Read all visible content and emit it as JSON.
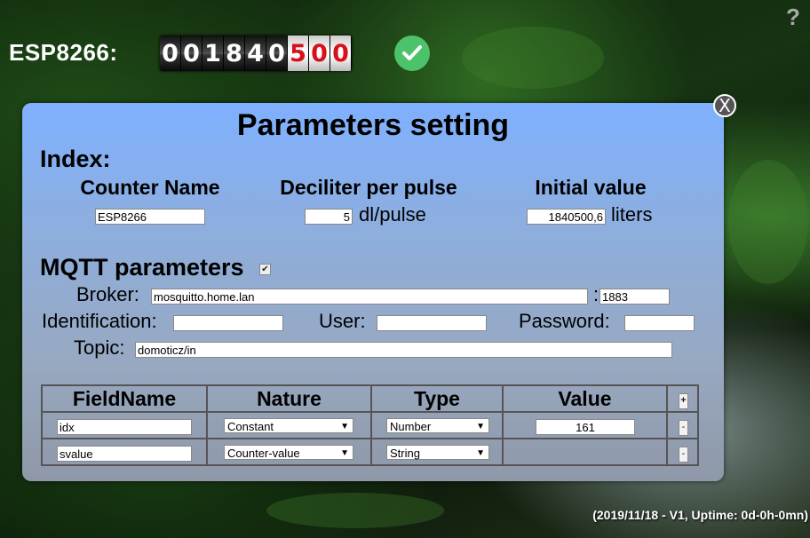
{
  "header": {
    "device_label": "ESP8266:",
    "counter_digits": [
      "0",
      "0",
      "1",
      "8",
      "4",
      "0",
      "5",
      "0",
      "0"
    ],
    "help_symbol": "?"
  },
  "dialog": {
    "title": "Parameters setting",
    "close_symbol": "X",
    "index": {
      "heading": "Index:",
      "counter_name_label": "Counter Name",
      "counter_name_value": "ESP8266",
      "deciliter_label": "Deciliter per pulse",
      "deciliter_value": "5",
      "deciliter_unit": "dl/pulse",
      "initial_label": "Initial value",
      "initial_value": "1840500,6",
      "initial_unit": "liters"
    },
    "mqtt": {
      "heading": "MQTT parameters",
      "enabled_mark": "✔",
      "broker_label": "Broker:",
      "broker_value": "mosquitto.home.lan",
      "port_separator": ":",
      "port_value": "1883",
      "identification_label": "Identification:",
      "identification_value": "",
      "user_label": "User:",
      "user_value": "",
      "password_label": "Password:",
      "password_value": "",
      "topic_label": "Topic:",
      "topic_value": "domoticz/in"
    },
    "fields_table": {
      "headers": [
        "FieldName",
        "Nature",
        "Type",
        "Value"
      ],
      "add_symbol": "+",
      "rows": [
        {
          "field": "idx",
          "nature": "Constant",
          "type": "Number",
          "value": "161",
          "remove_symbol": "-"
        },
        {
          "field": "svalue",
          "nature": "Counter-value",
          "type": "String",
          "value": "",
          "remove_symbol": "-"
        }
      ]
    }
  },
  "footer": {
    "status": "(2019/11/18 - V1, Uptime: 0d-0h-0mn)"
  },
  "colors": {
    "accent_green": "#4cc26a",
    "digit_red": "#d8101a"
  }
}
